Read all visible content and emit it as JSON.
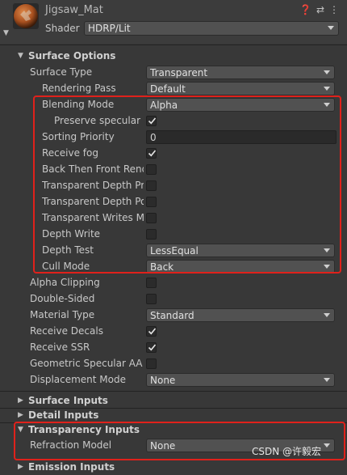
{
  "header": {
    "material_name": "Jigsaw_Mat",
    "shader_label": "Shader",
    "shader_value": "HDRP/Lit",
    "icons": [
      "help-icon",
      "preset-icon",
      "more-menu-icon"
    ]
  },
  "sections": {
    "surface_options": "Surface Options",
    "surface_inputs": "Surface Inputs",
    "detail_inputs": "Detail Inputs",
    "transparency_inputs": "Transparency Inputs",
    "emission_inputs": "Emission Inputs"
  },
  "surface_options": {
    "surface_type": {
      "label": "Surface Type",
      "value": "Transparent"
    },
    "rendering_pass": {
      "label": "Rendering Pass",
      "value": "Default"
    },
    "blending_mode": {
      "label": "Blending Mode",
      "value": "Alpha"
    },
    "preserve_specular": {
      "label": "Preserve specular lighting",
      "checked": true
    },
    "sorting_priority": {
      "label": "Sorting Priority",
      "value": "0"
    },
    "receive_fog": {
      "label": "Receive fog",
      "checked": true
    },
    "back_then_front": {
      "label": "Back Then Front Rendering",
      "checked": false
    },
    "transparent_depth_prepass": {
      "label": "Transparent Depth Prepass",
      "checked": false
    },
    "transparent_depth_postpass": {
      "label": "Transparent Depth Postpass",
      "checked": false
    },
    "transparent_writes_motion": {
      "label": "Transparent Writes Motion Vectors",
      "checked": false
    },
    "depth_write": {
      "label": "Depth Write",
      "checked": false
    },
    "depth_test": {
      "label": "Depth Test",
      "value": "LessEqual"
    },
    "cull_mode": {
      "label": "Cull Mode",
      "value": "Back"
    },
    "alpha_clipping": {
      "label": "Alpha Clipping",
      "checked": false
    },
    "double_sided": {
      "label": "Double-Sided",
      "checked": false
    },
    "material_type": {
      "label": "Material Type",
      "value": "Standard"
    },
    "receive_decals": {
      "label": "Receive Decals",
      "checked": true
    },
    "receive_ssr": {
      "label": "Receive SSR",
      "checked": true
    },
    "geometric_specular_aa": {
      "label": "Geometric Specular AA",
      "checked": false
    },
    "displacement_mode": {
      "label": "Displacement Mode",
      "value": "None"
    }
  },
  "transparency_inputs": {
    "refraction_model": {
      "label": "Refraction Model",
      "value": "None"
    }
  },
  "watermark": "CSDN @许毅宏",
  "colors": {
    "highlight": "#e0211b",
    "background": "#383838",
    "dropdown": "#515151"
  }
}
